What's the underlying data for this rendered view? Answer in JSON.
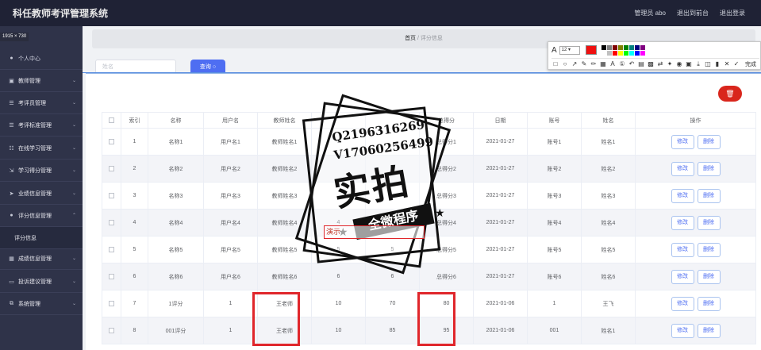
{
  "app": {
    "title": "科任教师考评管理系统",
    "admin_label": "管理员 abo",
    "to_front": "退出到前台",
    "logout": "退出登录",
    "size_badge": "1915 × 730"
  },
  "sidebar": {
    "items": [
      {
        "label": "个人中心",
        "icon": "user-icon"
      },
      {
        "label": "教师管理",
        "icon": "card-icon"
      },
      {
        "label": "考评员管理",
        "icon": "list-icon"
      },
      {
        "label": "考评标准管理",
        "icon": "list-icon"
      },
      {
        "label": "在线学习管理",
        "icon": "book-icon"
      },
      {
        "label": "学习得分管理",
        "icon": "expand-icon"
      },
      {
        "label": "业绩信息管理",
        "icon": "send-icon"
      },
      {
        "label": "评分信息管理",
        "icon": "user-icon"
      },
      {
        "label": "评分信息",
        "icon": ""
      },
      {
        "label": "成绩信息管理",
        "icon": "grid-icon"
      },
      {
        "label": "投诉建议管理",
        "icon": "monitor-icon"
      },
      {
        "label": "系统管理",
        "icon": "copy-icon"
      }
    ]
  },
  "breadcrumb": {
    "home": "首页",
    "sep": "/",
    "current": "评分信息"
  },
  "search": {
    "placeholder": "姓名",
    "button": "查询"
  },
  "delete_all": "删除",
  "table": {
    "headers": [
      "索引",
      "名称",
      "用户名",
      "教师姓名",
      "考评得分",
      "评分得分",
      "总得分",
      "日期",
      "账号",
      "姓名",
      "操作"
    ],
    "header_index": "索引",
    "header_name": "名称",
    "header_user": "用户名",
    "header_teacher": "教师姓名",
    "header_s1": "",
    "header_s2": "",
    "header_total": "总得分",
    "header_date": "日期",
    "header_acct": "账号",
    "header_realname": "姓名",
    "header_ops": "操作",
    "edit": "修改",
    "delete": "删除",
    "rows": [
      {
        "idx": "1",
        "name": "名称1",
        "user": "用户名1",
        "teacher": "教师姓名1",
        "s1": "1",
        "s2": "",
        "total": "总得分1",
        "date": "2021-01-27",
        "acct": "账号1",
        "realname": "姓名1"
      },
      {
        "idx": "2",
        "name": "名称2",
        "user": "用户名2",
        "teacher": "教师姓名2",
        "s1": "",
        "s2": "",
        "total": "总得分2",
        "date": "2021-01-27",
        "acct": "账号2",
        "realname": "姓名2"
      },
      {
        "idx": "3",
        "name": "名称3",
        "user": "用户名3",
        "teacher": "教师姓名3",
        "s1": "",
        "s2": "",
        "total": "总得分3",
        "date": "2021-01-27",
        "acct": "账号3",
        "realname": "姓名3"
      },
      {
        "idx": "4",
        "name": "名称4",
        "user": "用户名4",
        "teacher": "教师姓名4",
        "s1": "4",
        "s2": "",
        "total": "总得分4",
        "date": "2021-01-27",
        "acct": "账号4",
        "realname": "姓名4"
      },
      {
        "idx": "5",
        "name": "名称5",
        "user": "用户名5",
        "teacher": "教师姓名5",
        "s1": "5",
        "s2": "5",
        "total": "总得分5",
        "date": "2021-01-27",
        "acct": "账号5",
        "realname": "姓名5"
      },
      {
        "idx": "6",
        "name": "名称6",
        "user": "用户名6",
        "teacher": "教师姓名6",
        "s1": "6",
        "s2": "6",
        "total": "总得分6",
        "date": "2021-01-27",
        "acct": "账号6",
        "realname": "姓名6"
      },
      {
        "idx": "7",
        "name": "1评分",
        "user": "1",
        "teacher": "王老师",
        "s1": "10",
        "s2": "70",
        "total": "80",
        "date": "2021-01-06",
        "acct": "1",
        "realname": "王飞"
      },
      {
        "idx": "8",
        "name": "001评分",
        "user": "1",
        "teacher": "王老师",
        "s1": "10",
        "s2": "85",
        "total": "95",
        "date": "2021-01-06",
        "acct": "001",
        "realname": "姓名1"
      }
    ]
  },
  "snap_toolbar": {
    "font_size": "12",
    "done": "完成",
    "current_color": "#ef1010",
    "palette": [
      "#000000",
      "#808080",
      "#800000",
      "#808000",
      "#008000",
      "#008080",
      "#000080",
      "#800080",
      "#ffffff",
      "#c0c0c0",
      "#ff0000",
      "#ffff00",
      "#00ff00",
      "#00ffff",
      "#0000ff",
      "#ff00ff"
    ]
  },
  "stamp": {
    "qq": "Q2196316269",
    "vx": "V17060256499",
    "main_text": "实拍",
    "banner": "全微程序",
    "annotation": "演示"
  },
  "colors": {
    "header_bg": "#1f2235",
    "sidebar_bg": "#2f3349",
    "primary": "#4e6ef2",
    "danger": "#d9261c",
    "highlight": "#e0262b"
  }
}
